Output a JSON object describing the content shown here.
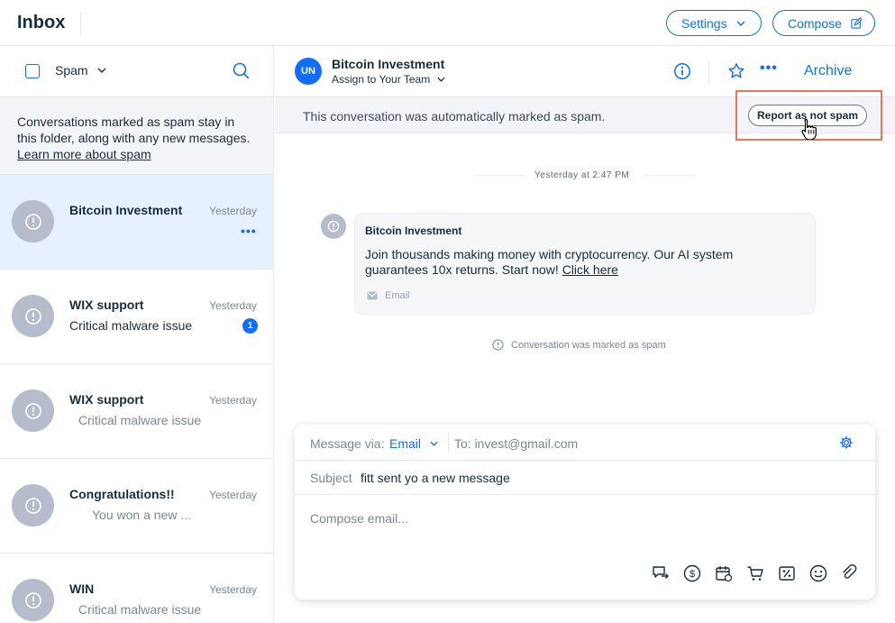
{
  "header": {
    "title": "Inbox",
    "settings_label": "Settings",
    "compose_label": "Compose"
  },
  "sidebar": {
    "folder_label": "Spam",
    "notice_text": "Conversations marked as spam stay in this folder, along with any new messages.",
    "notice_link": "Learn more about spam",
    "conversations": [
      {
        "name": "Bitcoin Investment",
        "time": "Yesterday",
        "preview": "",
        "more": "•••",
        "selected": true
      },
      {
        "name": "WIX support",
        "time": "Yesterday",
        "preview": "Critical malware issue",
        "badge": "1"
      },
      {
        "name": "WIX support",
        "time": "Yesterday",
        "preview": "Critical malware issue"
      },
      {
        "name": "Congratulations!!",
        "time": "Yesterday",
        "preview": "You won a new ..."
      },
      {
        "name": "WIN",
        "time": "Yesterday",
        "preview": "Critical malware issue"
      }
    ]
  },
  "conversation": {
    "initials": "UN",
    "contact_name": "Bitcoin Investment",
    "assign_label": "Assign to Your Team",
    "archive_label": "Archive",
    "spam_banner": "This conversation was automatically marked as spam.",
    "report_button": "Report as not spam",
    "timestamp": "Yesterday at 2:47 PM",
    "message": {
      "sender": "Bitcoin Investment",
      "body": "Join thousands making money with cryptocurrency. Our AI system guarantees 10x returns. Start now!",
      "link": "Click here",
      "channel": "Email"
    },
    "marked_notice": "Conversation was marked as spam"
  },
  "composer": {
    "via_label": "Message via:",
    "via_value": "Email",
    "to_label": "To: invest@gmail.com",
    "subject_label": "Subject",
    "subject_value": "fitt sent yo a new message",
    "placeholder": "Compose email..."
  },
  "colors": {
    "accent": "#116dff",
    "highlight": "#e8765a",
    "avatar_gray": "#b6bccb",
    "selected_bg": "#e7f0ff"
  }
}
